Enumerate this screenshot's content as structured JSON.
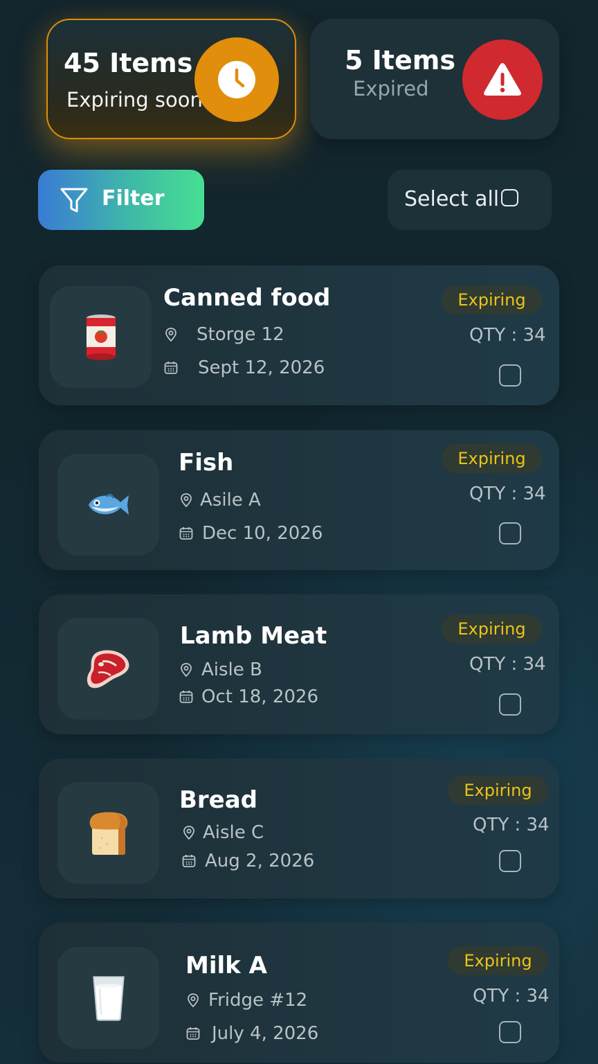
{
  "summary": {
    "expiring_soon": {
      "count": "45 Items",
      "label": "Expiring soon",
      "icon": "clock-icon",
      "color": "#e08e0b"
    },
    "expired": {
      "count": "5 Items",
      "label": "Expired",
      "icon": "warning-icon",
      "color": "#d0292f"
    }
  },
  "toolbar": {
    "filter_label": "Filter",
    "select_all_label": "Select all"
  },
  "colors": {
    "badge_text": "#ecc416",
    "filter_gradient_start": "#3a7bd5",
    "filter_gradient_end": "#47df92"
  },
  "items": [
    {
      "name": "Canned food",
      "location": "Storge  12",
      "date": "Sept 12, 2026",
      "status": "Expiring",
      "qty": "QTY : 34",
      "emoji": "🥫",
      "checked": false
    },
    {
      "name": "Fish",
      "location": "Asile A",
      "date": "Dec 10, 2026",
      "status": "Expiring",
      "qty": "QTY : 34",
      "emoji": "🐟",
      "checked": false
    },
    {
      "name": "Lamb Meat",
      "location": "Aisle B",
      "date": "Oct 18, 2026",
      "status": "Expiring",
      "qty": "QTY : 34",
      "emoji": "🥩",
      "checked": false
    },
    {
      "name": "Bread",
      "location": "Aisle C",
      "date": "Aug 2, 2026",
      "status": "Expiring",
      "qty": "QTY : 34",
      "emoji": "🍞",
      "checked": false
    },
    {
      "name": "Milk A",
      "location": "Fridge #12",
      "date": "July  4, 2026",
      "status": "Expiring",
      "qty": "QTY : 34",
      "emoji": "🥛",
      "checked": false
    }
  ]
}
